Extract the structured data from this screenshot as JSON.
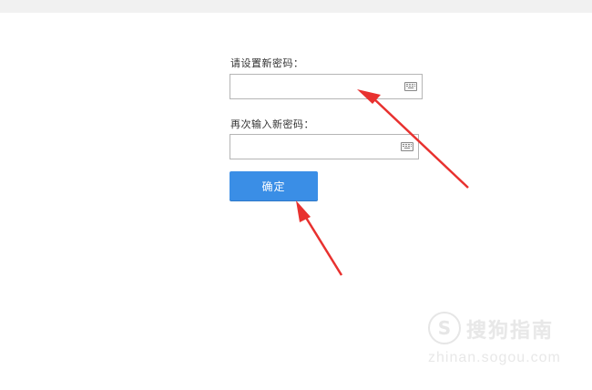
{
  "form": {
    "new_password_label": "请设置新密码：",
    "confirm_password_label": "再次输入新密码：",
    "new_password_value": "",
    "confirm_password_value": "",
    "confirm_button_label": "确定"
  },
  "icons": {
    "keyboard": "keyboard-icon"
  },
  "annotations": {
    "arrow_color": "#e8312f"
  },
  "watermark": {
    "logo_letter": "S",
    "title": "搜狗指南",
    "subtitle": "zhinan.sogou.com"
  },
  "colors": {
    "button": "#3a8ee6",
    "top_band": "#f1f1f1"
  }
}
